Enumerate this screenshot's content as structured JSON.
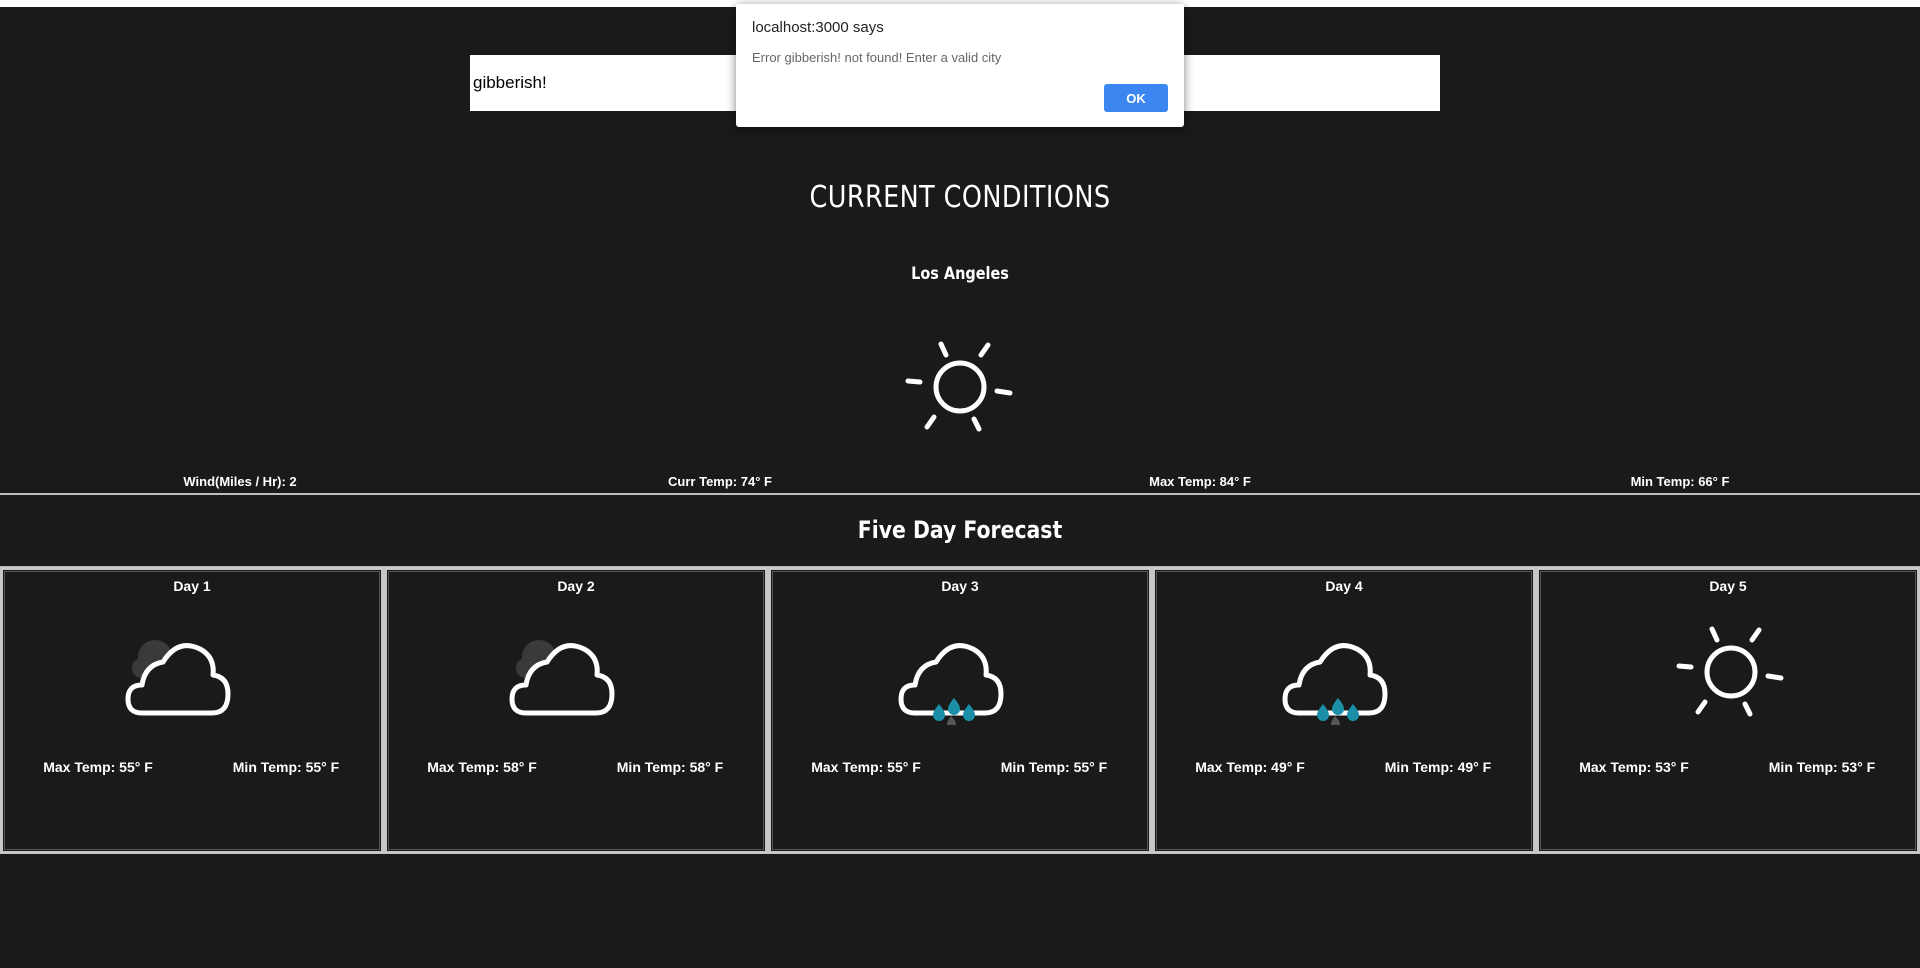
{
  "search": {
    "value": "gibberish!"
  },
  "dialog": {
    "title": "localhost:3000 says",
    "message": "Error gibberish! not found! Enter a valid city",
    "ok_label": "OK"
  },
  "current": {
    "title": "CURRENT CONDITIONS",
    "city": "Los Angeles",
    "icon": "sun-icon",
    "wind": "Wind(Miles / Hr): 2",
    "curr_temp": "Curr Temp: 74° F",
    "max_temp": "Max Temp: 84° F",
    "min_temp": "Min Temp: 66° F"
  },
  "forecast": {
    "title": "Five Day Forecast",
    "days": [
      {
        "label": "Day 1",
        "icon": "cloudy-icon",
        "max": "Max Temp: 55° F",
        "min": "Min Temp: 55° F"
      },
      {
        "label": "Day 2",
        "icon": "cloudy-icon",
        "max": "Max Temp: 58° F",
        "min": "Min Temp: 58° F"
      },
      {
        "label": "Day 3",
        "icon": "rain-icon",
        "max": "Max Temp: 55° F",
        "min": "Min Temp: 55° F"
      },
      {
        "label": "Day 4",
        "icon": "rain-icon",
        "max": "Max Temp: 49° F",
        "min": "Min Temp: 49° F"
      },
      {
        "label": "Day 5",
        "icon": "sun-icon",
        "max": "Max Temp: 53° F",
        "min": "Min Temp: 53° F"
      }
    ]
  },
  "colors": {
    "background": "#1a1a1a",
    "rain_drop": "#1b8fa8",
    "dialog_button": "#3b86f0"
  }
}
